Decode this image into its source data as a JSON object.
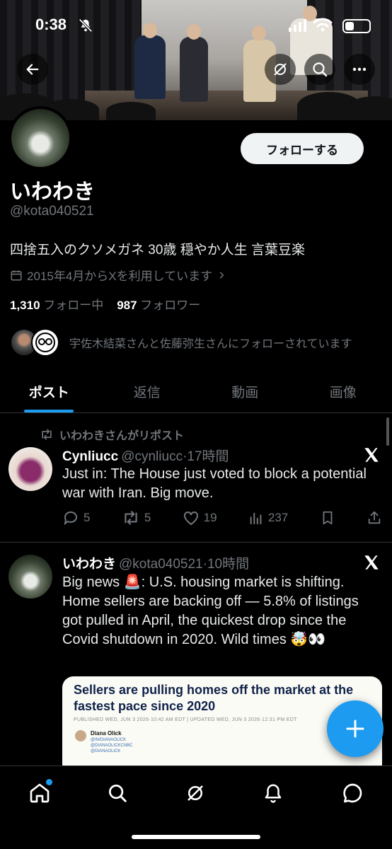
{
  "status": {
    "time": "0:38"
  },
  "profile": {
    "name": "いわわき",
    "handle": "@kota040521",
    "bio": "四捨五入のクソメガネ 30歳 穏やか人生 言葉豆楽",
    "joined": "2015年4月からXを利用しています",
    "following_count": "1,310",
    "following_label": "フォロー中",
    "followers_count": "987",
    "followers_label": "フォロワー",
    "followed_by": "宇佐木結菜さんと佐藤弥生さんにフォローされています",
    "follow_button": "フォローする"
  },
  "tabs": [
    {
      "label": "ポスト",
      "active": true
    },
    {
      "label": "返信"
    },
    {
      "label": "動画"
    },
    {
      "label": "画像"
    }
  ],
  "posts": [
    {
      "repost_label": "いわわきさんがリポスト",
      "author": "Cynliucc",
      "handle": "@cynliucc",
      "time": "17時間",
      "text": "Just in: The House just voted to block a potential war with Iran. Big move.",
      "replies": "5",
      "reposts": "5",
      "likes": "19",
      "views": "237"
    },
    {
      "author": "いわわき",
      "handle": "@kota040521",
      "time": "10時間",
      "text": "Big news 🚨: U.S. housing market is shifting. Home sellers are backing off — 5.8% of listings got pulled in April, the quickest drop since the Covid shutdown in 2020. Wild times 🤯👀",
      "card": {
        "title": "Sellers are pulling homes off the market at the fastest pace since 2020",
        "meta": "PUBLISHED WED, JUN 3 2026·10:42 AM EDT | UPDATED WED, JUN 3 2026·12:31 PM EDT",
        "author": "Diana Olick",
        "sub1": "@IN/DIANAOLICK",
        "sub2": "@DIANAOLICKCNBC",
        "sub3": "@DIANAOLICK"
      }
    }
  ],
  "icons": {
    "back": "back-arrow-icon",
    "grok": "grok-icon",
    "search": "search-icon",
    "more": "more-icon"
  },
  "colors": {
    "accent": "#1d9bf0",
    "muted": "#71767b",
    "background": "#000000"
  }
}
